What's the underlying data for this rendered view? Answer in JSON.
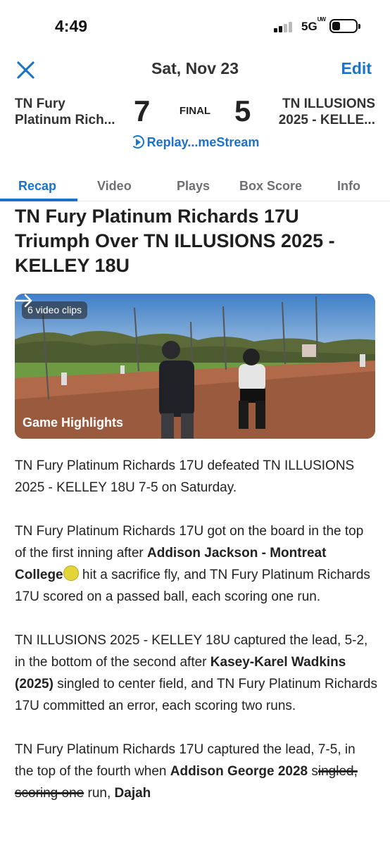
{
  "status_bar": {
    "time": "4:49",
    "network": "5G",
    "network_suffix": "UW"
  },
  "nav": {
    "title": "Sat, Nov 23",
    "edit_label": "Edit",
    "close_icon": "close-icon"
  },
  "scoreboard": {
    "away_team_line1": "TN Fury",
    "away_team_line2": "Platinum Rich...",
    "away_score": "7",
    "status": "FINAL",
    "home_score": "5",
    "home_team_line1": "TN ILLUSIONS",
    "home_team_line2": "2025 - KELLE...",
    "replay_label": "Replay...meStream"
  },
  "tabs": [
    {
      "label": "Recap",
      "active": true
    },
    {
      "label": "Video",
      "active": false
    },
    {
      "label": "Plays",
      "active": false
    },
    {
      "label": "Box Score",
      "active": false
    },
    {
      "label": "Info",
      "active": false
    }
  ],
  "headline": "TN Fury Platinum Richards 17U Triumph Over TN ILLUSIONS 2025 - KELLEY 18U",
  "video": {
    "clips_badge": "6 video clips",
    "label": "Game Highlights"
  },
  "article": {
    "p1": "TN Fury Platinum Richards 17U defeated TN ILLUSIONS 2025 - KELLEY 18U 7-5 on Saturday.",
    "p2_a": "TN Fury Platinum Richards 17U got on the board in the top of the first inning after ",
    "p2_player": "Addison Jackson - Montreat College",
    "p2_b": " hit a sacrifice fly, and TN Fury Platinum Richards 17U scored on a passed ball, each scoring one run.",
    "p3_a": "TN ILLUSIONS 2025 - KELLEY 18U captured the lead, 5-2, in the bottom of the second after ",
    "p3_player": "Kasey-Karel Wadkins (2025)",
    "p3_b": " singled to center field, and TN Fury Platinum Richards 17U committed an error, each scoring two runs.",
    "p4_a": "TN Fury Platinum Richards 17U captured the lead, 7-5, in the top of the fourth when ",
    "p4_player": "Addison George 2028",
    "p4_b": " s",
    "p4_strike": "ingled, scoring one",
    "p4_c": " run, ",
    "p4_player2": "Dajah"
  },
  "colors": {
    "accent": "#1a73c8",
    "text": "#222222",
    "tab_inactive": "#6e6e73"
  }
}
